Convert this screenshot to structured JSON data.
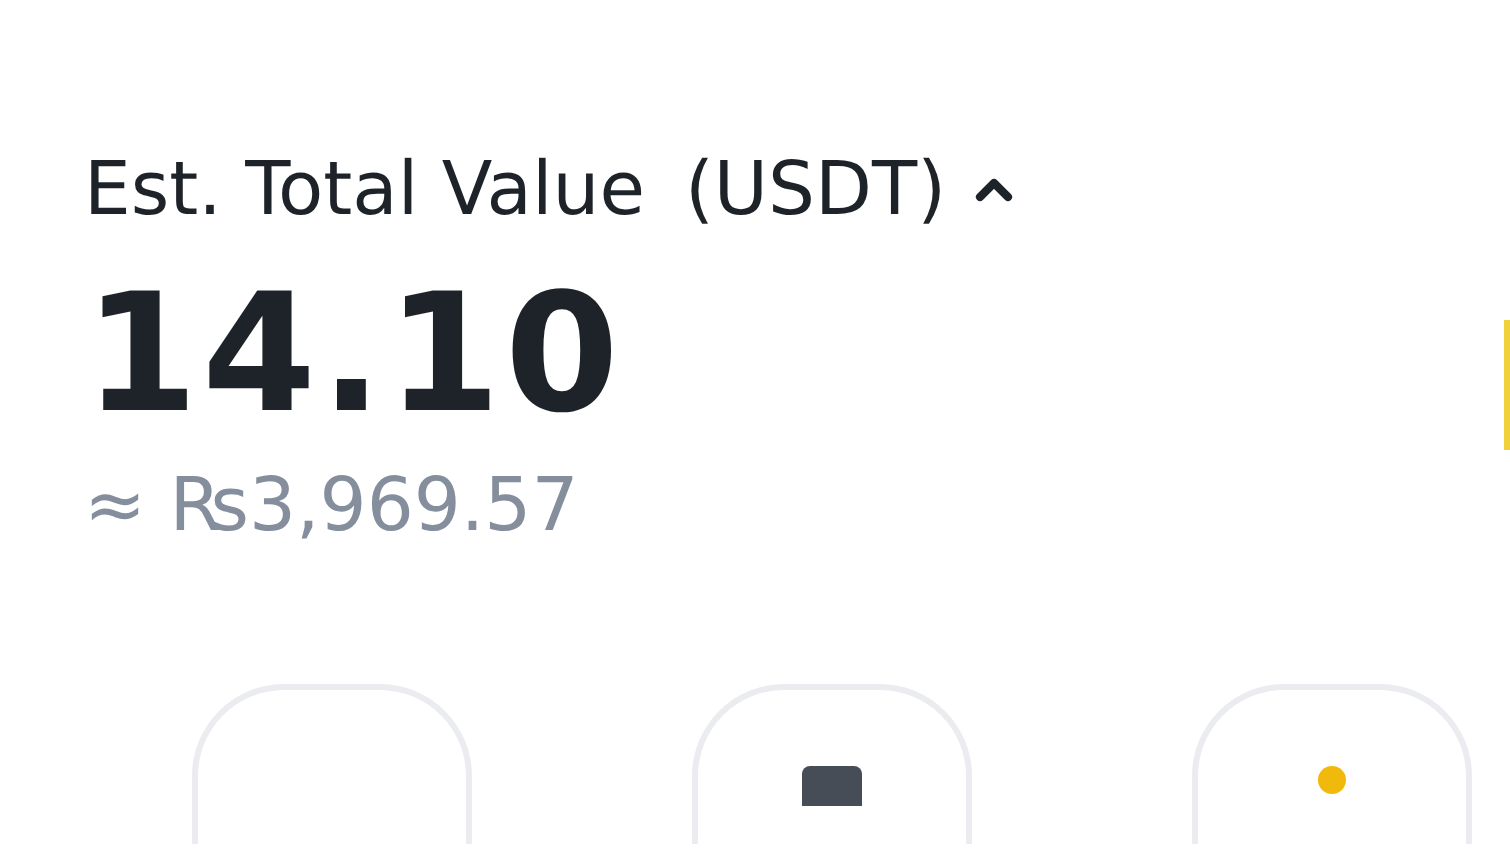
{
  "balance": {
    "label": "Est. Total Value",
    "currency": "(USDT)",
    "expanded": true,
    "value": "14.10",
    "fiat_value": "≈ ₨3,969.57"
  }
}
